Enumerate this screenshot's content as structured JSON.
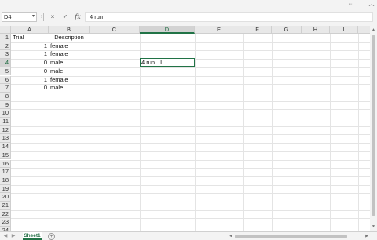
{
  "window": {
    "collapse_icon": "chevron-up-icon"
  },
  "formula_bar": {
    "name_box": "D4",
    "cancel_glyph": "×",
    "enter_glyph": "✓",
    "fx_label": "fx",
    "content": "4 run"
  },
  "grid": {
    "columns": [
      "A",
      "B",
      "C",
      "D",
      "E",
      "F",
      "G",
      "H",
      "I"
    ],
    "active_column": "D",
    "rows": [
      "1",
      "2",
      "3",
      "4",
      "5",
      "6",
      "7",
      "8",
      "9",
      "10",
      "11",
      "12",
      "13",
      "14",
      "15",
      "16",
      "17",
      "18",
      "19",
      "20",
      "21",
      "22",
      "23",
      "24"
    ],
    "active_row": "4",
    "cells": {
      "A1": "Trial",
      "B1": "Description",
      "A2": "1",
      "B2": "female",
      "A3": "1",
      "B3": "female",
      "A4": "0",
      "B4": "male",
      "A5": "0",
      "B5": "male",
      "A6": "1",
      "B6": "female",
      "A7": "0",
      "B7": "male"
    },
    "active_cell_edit": "4 run"
  },
  "sheets": {
    "tabs": [
      "Sheet1"
    ],
    "active": "Sheet1",
    "add_label": "+"
  },
  "colors": {
    "accent": "#217346",
    "header_bg": "#e8e8e8",
    "active_header_bg": "#d3d3d3"
  }
}
